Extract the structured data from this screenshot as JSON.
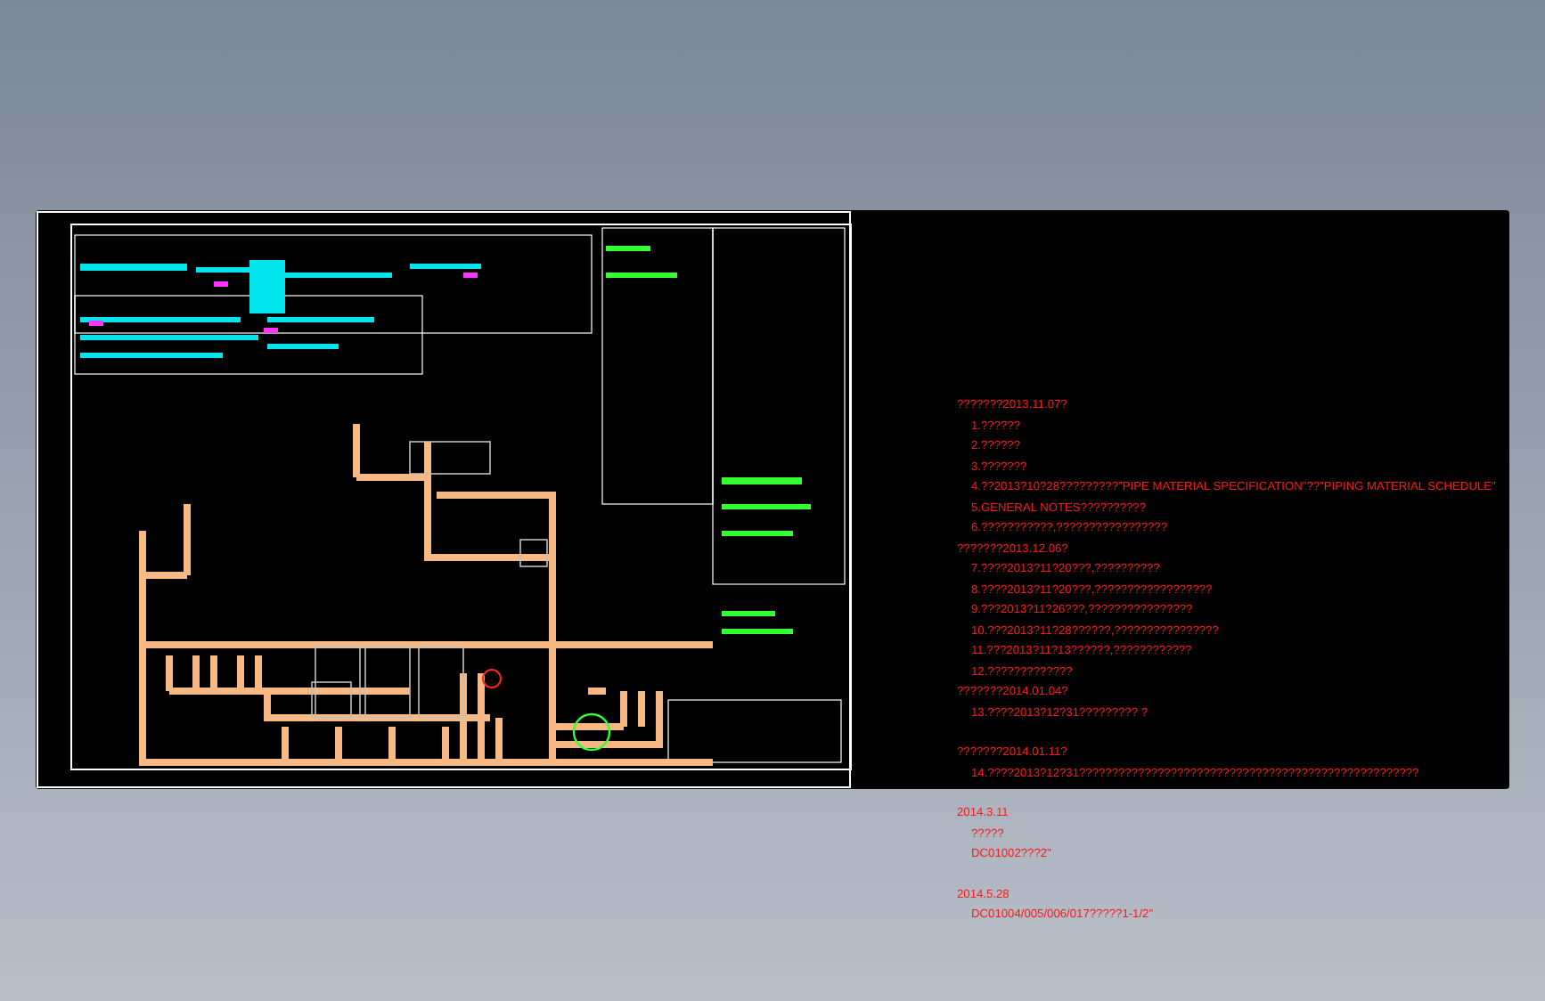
{
  "revision_notes": [
    {
      "kind": "heading",
      "text": "???????2013.11.07?"
    },
    {
      "kind": "item",
      "text": "1.??????"
    },
    {
      "kind": "item",
      "text": "2.??????"
    },
    {
      "kind": "item",
      "text": "3.???????"
    },
    {
      "kind": "item",
      "text": "4.??2013?10?28?????????\"PIPE MATERIAL SPECIFICATION\"??\"PIPING MATERIAL SCHEDULE\""
    },
    {
      "kind": "item",
      "text": "5.GENERAL NOTES??????????"
    },
    {
      "kind": "item",
      "text": "6.???????????,?????????????????"
    },
    {
      "kind": "heading",
      "text": "???????2013.12.06?"
    },
    {
      "kind": "item",
      "text": "7.????2013?11?20???,??????????"
    },
    {
      "kind": "item",
      "text": "8.????2013?11?20???,??????????????????"
    },
    {
      "kind": "item",
      "text": "9.???2013?11?26???,????????????????"
    },
    {
      "kind": "item",
      "text": "10.???2013?11?28??????,????????????????"
    },
    {
      "kind": "item",
      "text": "11.???2013?11?13??????,????????????"
    },
    {
      "kind": "item",
      "text": "12.?????????????"
    },
    {
      "kind": "heading",
      "text": "???????2014.01.04?"
    },
    {
      "kind": "item",
      "text": "13.????2013?12?31????????? ?"
    },
    {
      "kind": "section",
      "text": "???????2014.01.11?"
    },
    {
      "kind": "item",
      "text": "14.????2013?12?31????????????????????????????????????????????????????"
    },
    {
      "kind": "section",
      "text": "2014.3.11"
    },
    {
      "kind": "item",
      "text": "?????"
    },
    {
      "kind": "item",
      "text": "DC01002???2\""
    },
    {
      "kind": "section",
      "text": "2014.5.28"
    },
    {
      "kind": "item",
      "text": "DC01004/005/006/017?????1-1/2\""
    }
  ]
}
